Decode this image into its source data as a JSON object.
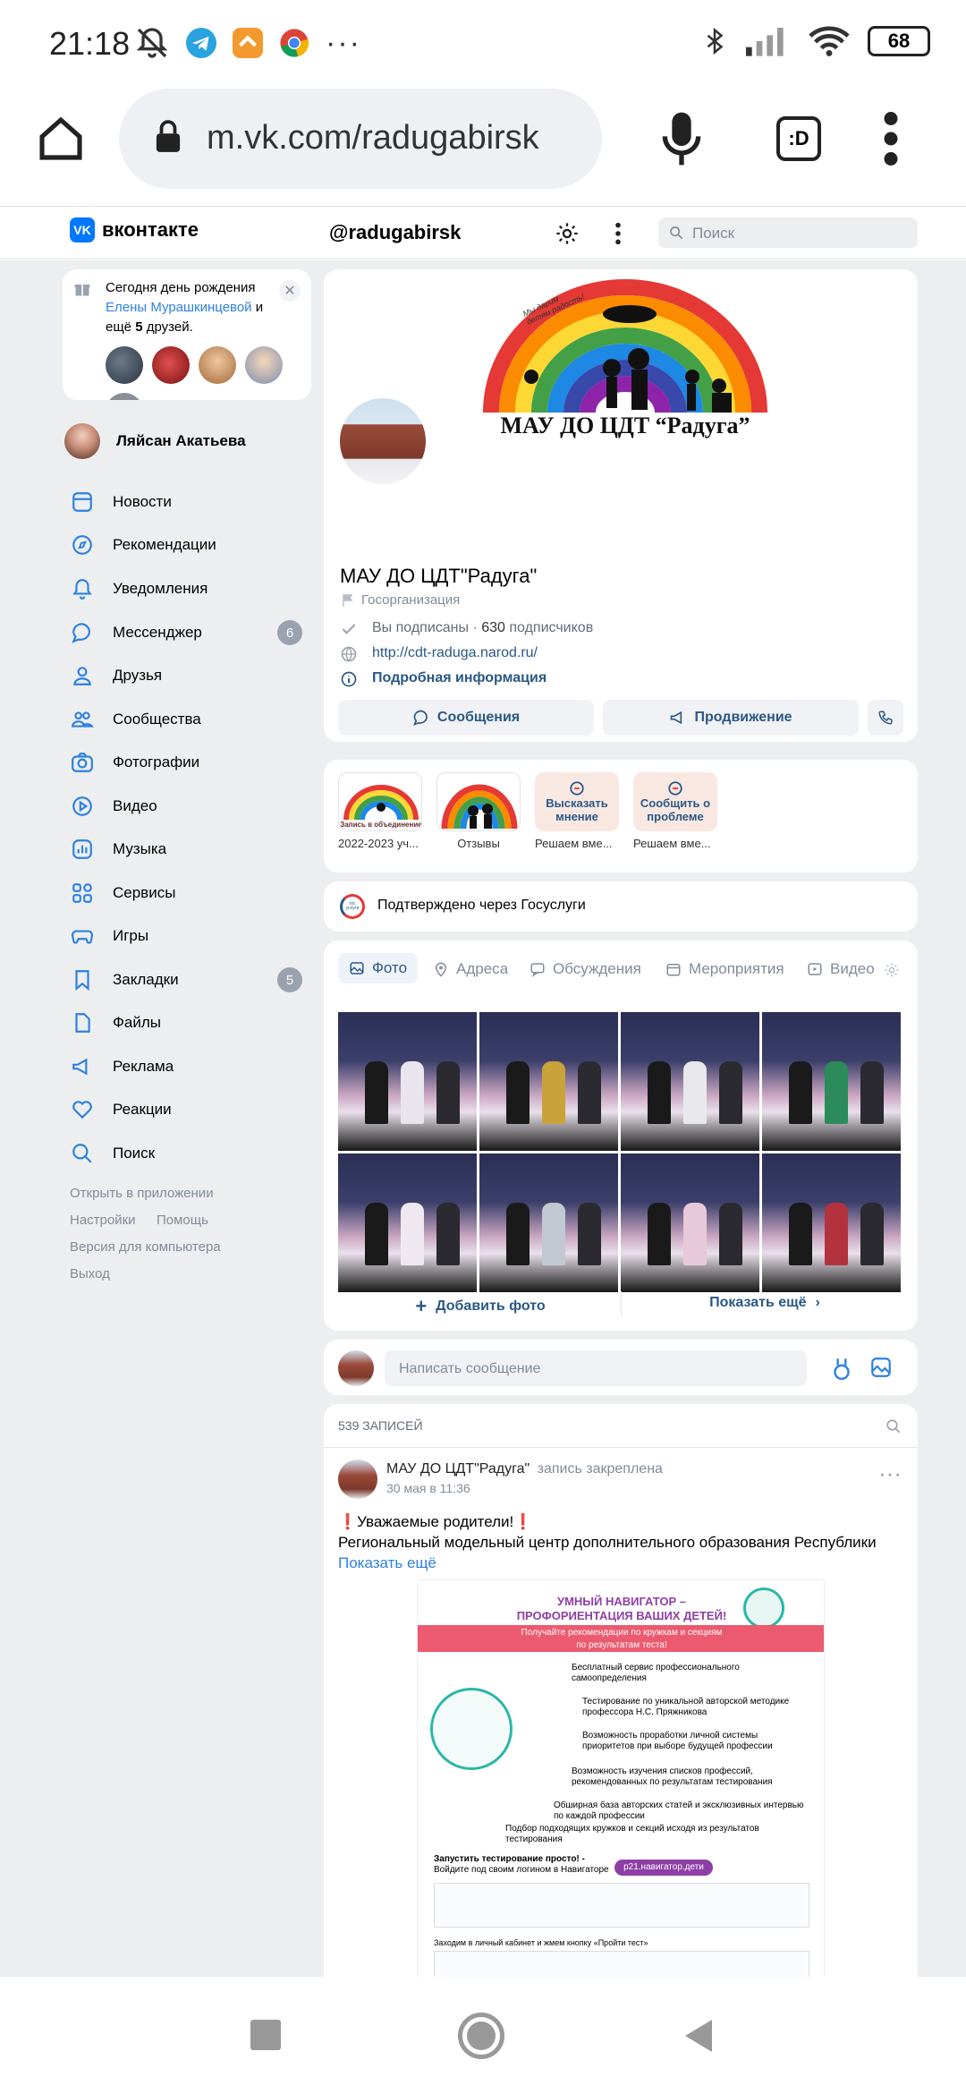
{
  "status": {
    "time": "21:18",
    "battery": "68"
  },
  "browser": {
    "url": "m.vk.com/radugabirsk"
  },
  "vk_header": {
    "logo_text": "вконтакте",
    "handle": "@radugabirsk",
    "search_placeholder": "Поиск"
  },
  "birthday": {
    "line1": "Сегодня день рождения",
    "name": "Елены Мурашкинцевой",
    "and": "и",
    "more_prefix": "ещё",
    "more_count": "5",
    "more_suffix": "друзей."
  },
  "sidebar": {
    "user": "Ляйсан Акатьева",
    "items": [
      {
        "label": "Новости"
      },
      {
        "label": "Рекомендации"
      },
      {
        "label": "Уведомления"
      },
      {
        "label": "Мессенджер",
        "badge": "6"
      },
      {
        "label": "Друзья"
      },
      {
        "label": "Сообщества"
      },
      {
        "label": "Фотографии"
      },
      {
        "label": "Видео"
      },
      {
        "label": "Музыка"
      },
      {
        "label": "Сервисы"
      },
      {
        "label": "Игры"
      },
      {
        "label": "Закладки",
        "badge": "5"
      },
      {
        "label": "Файлы"
      },
      {
        "label": "Реклама"
      },
      {
        "label": "Реакции"
      },
      {
        "label": "Поиск"
      }
    ],
    "footer": {
      "open_app": "Открыть в приложении",
      "settings": "Настройки",
      "help": "Помощь",
      "desktop": "Версия для компьютера",
      "logout": "Выход"
    }
  },
  "profile": {
    "cover_caption": "МАУ ДО ЦДТ “Радуга”",
    "cover_script": "Мы дарим детям радость!",
    "name": "МАУ ДО ЦДТ\"Радуга\"",
    "category": "Госорганизация",
    "subscribed": "Вы подписаны",
    "subscribers_count": "630",
    "subscribers_label": "подписчиков",
    "site": "http://cdt-raduga.narod.ru/",
    "more_info": "Подробная информация",
    "messages_btn": "Сообщения",
    "promote_btn": "Продвижение"
  },
  "stories": [
    {
      "title": "2022-2023 уч...",
      "thumb": "Запись в объединение"
    },
    {
      "title": "Отзывы",
      "thumb": ""
    },
    {
      "title": "Решаем вме...",
      "thumb": "Высказать мнение"
    },
    {
      "title": "Решаем вме...",
      "thumb": "Сообщить о проблеме"
    }
  ],
  "gosuslugi": {
    "text": "Подтверждено через Госуслуги",
    "logo": "гос услуги"
  },
  "tabs": [
    "Фото",
    "Адреса",
    "Обсуждения",
    "Мероприятия",
    "Видео"
  ],
  "photos_actions": {
    "add": "Добавить фото",
    "show_more": "Показать ещё"
  },
  "composer": {
    "placeholder": "Написать сообщение"
  },
  "wall": {
    "count": "539",
    "label": "ЗАПИСЕЙ"
  },
  "post": {
    "author": "МАУ ДО ЦДТ\"Радуга\"",
    "pinned": "запись закреплена",
    "date": "30 мая в 11:36",
    "line1": "❗️Уважаемые родители!❗️",
    "line2": "Региональный модельный центр дополнительного образования Республики",
    "show_more": "Показать ещё",
    "image": {
      "title1": "УМНЫЙ НАВИГАТОР –",
      "title2": "ПРОФОРИЕНТАЦИЯ ВАШИХ ДЕТЕЙ!",
      "banner1": "Получайте рекомендации по кружкам и секциям",
      "banner2": "по результатам теста!",
      "b1": "Бесплатный сервис профессионального самоопределения",
      "b2": "Тестирование по уникальной авторской методике профессора Н.С. Пряжникова",
      "b3": "Возможность проработки личной системы приоритетов при выборе будущей профессии",
      "b4": "Возможность изучения списков профессий, рекомендованных по результатам тестирования",
      "b5": "Обширная база авторских статей и эксклюзивных интервью по каждой профессии",
      "b6": "Подбор подходящих кружков и секций исходя из результатов тестирования",
      "start1": "Запустить тестирование просто! -",
      "start2": "Войдите под своим логином в Навигаторе",
      "domain": "р21.навигатор.дети",
      "step": "Заходим в личный кабинет и жмем кнопку «Пройти тест»"
    }
  }
}
